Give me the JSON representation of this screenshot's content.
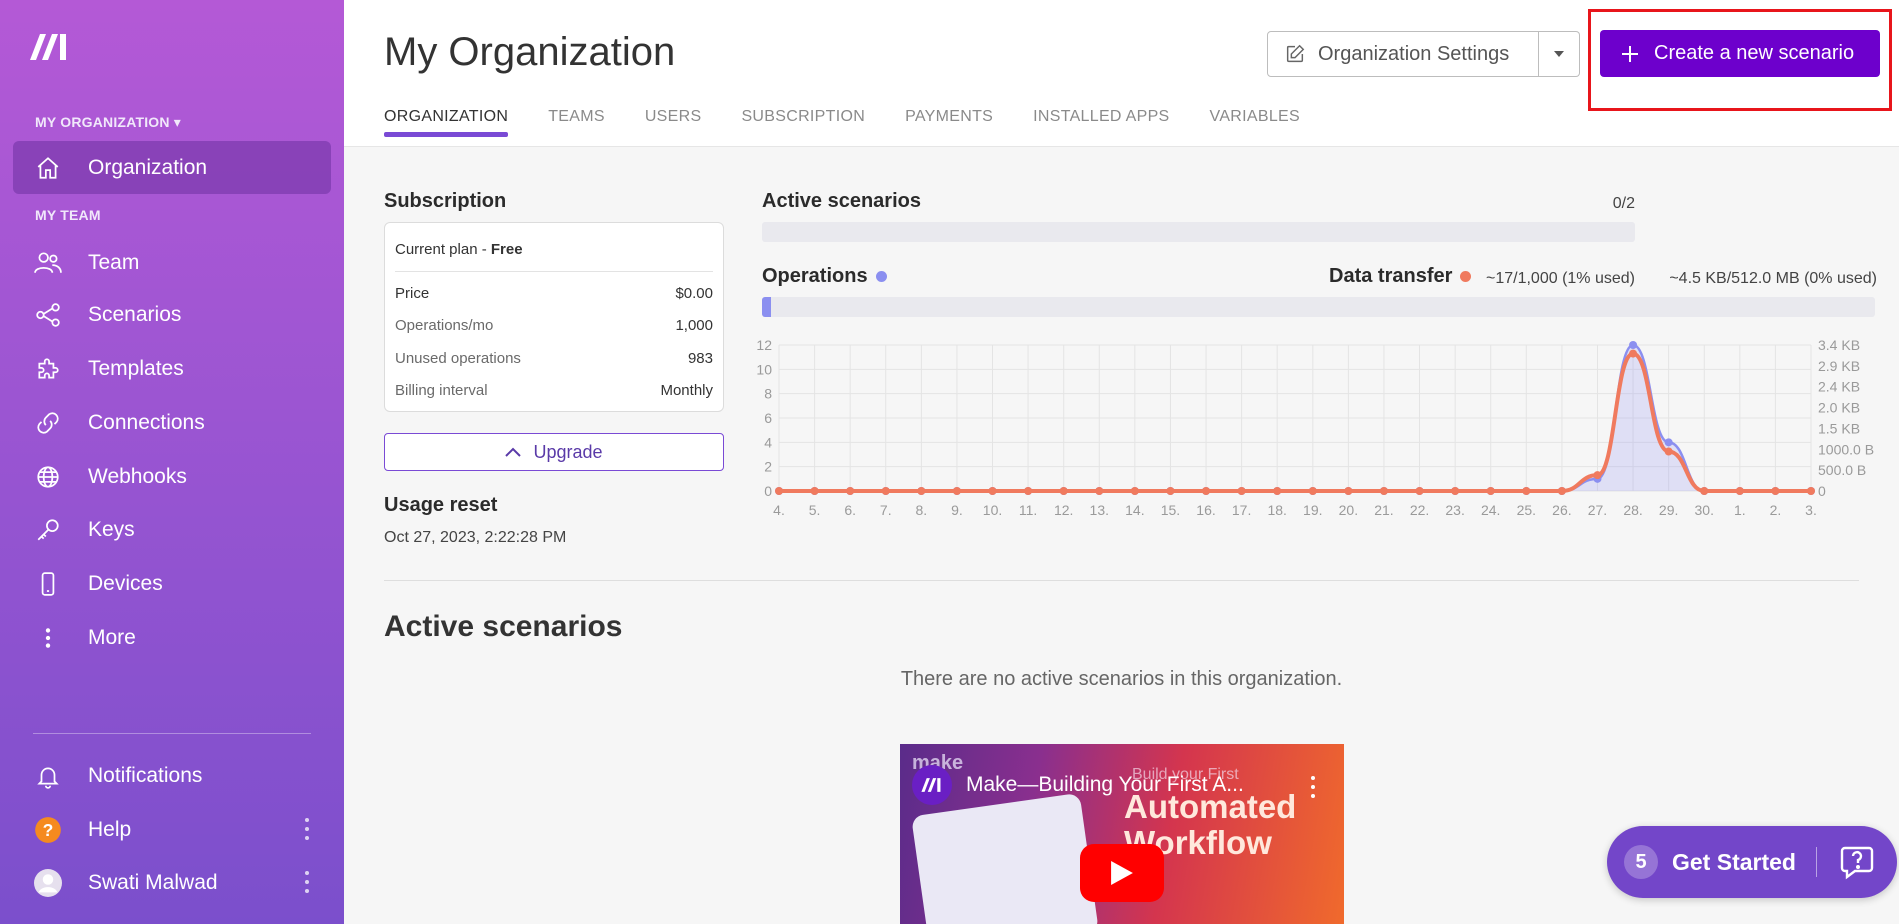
{
  "sidebar": {
    "org_label": "MY ORGANIZATION",
    "team_label": "MY TEAM",
    "items": [
      {
        "label": "Organization",
        "icon": "home-icon"
      },
      {
        "label": "Team",
        "icon": "users-icon"
      },
      {
        "label": "Scenarios",
        "icon": "share-nodes-icon"
      },
      {
        "label": "Templates",
        "icon": "puzzle-icon"
      },
      {
        "label": "Connections",
        "icon": "link-icon"
      },
      {
        "label": "Webhooks",
        "icon": "globe-icon"
      },
      {
        "label": "Keys",
        "icon": "key-icon"
      },
      {
        "label": "Devices",
        "icon": "mobile-icon"
      },
      {
        "label": "More",
        "icon": "more-vertical-icon"
      }
    ],
    "bottom": [
      {
        "label": "Notifications",
        "icon": "bell-icon"
      },
      {
        "label": "Help",
        "icon": "help-icon"
      },
      {
        "label": "Swati Malwad",
        "icon": "avatar-icon"
      }
    ]
  },
  "header": {
    "title": "My Organization",
    "settings_label": "Organization Settings",
    "create_label": "Create a new scenario",
    "tabs": [
      "ORGANIZATION",
      "TEAMS",
      "USERS",
      "SUBSCRIPTION",
      "PAYMENTS",
      "INSTALLED APPS",
      "VARIABLES"
    ],
    "active_tab": "ORGANIZATION"
  },
  "subscription": {
    "title": "Subscription",
    "plan_prefix": "Current plan - ",
    "plan_name": "Free",
    "rows": [
      {
        "label": "Price",
        "value": "$0.00"
      },
      {
        "label": "Operations/mo",
        "value": "1,000"
      },
      {
        "label": "Unused operations",
        "value": "983"
      },
      {
        "label": "Billing interval",
        "value": "Monthly"
      }
    ],
    "upgrade_label": "Upgrade",
    "usage_reset_title": "Usage reset",
    "usage_reset_date": "Oct 27, 2023, 2:22:28 PM"
  },
  "stats": {
    "active_scenarios": {
      "title": "Active scenarios",
      "value": "0/2",
      "fraction": 0
    },
    "operations": {
      "title": "Operations",
      "value": "~17/1,000 (1% used)",
      "fraction": 0.01,
      "color": "#8b8ff0"
    },
    "data_transfer": {
      "title": "Data transfer",
      "value": "~4.5 KB/512.0 MB (0% used)",
      "fraction": 0,
      "color": "#f07a5e"
    }
  },
  "chart_data": {
    "type": "line",
    "categories": [
      "4.",
      "5.",
      "6.",
      "7.",
      "8.",
      "9.",
      "10.",
      "11.",
      "12.",
      "13.",
      "14.",
      "15.",
      "16.",
      "17.",
      "18.",
      "19.",
      "20.",
      "21.",
      "22.",
      "23.",
      "24.",
      "25.",
      "26.",
      "27.",
      "28.",
      "29.",
      "30.",
      "1.",
      "2.",
      "3."
    ],
    "y_left_ticks": [
      "0",
      "2",
      "4",
      "6",
      "8",
      "10",
      "12"
    ],
    "y_right_ticks": [
      "0",
      "500.0 B",
      "1000.0 B",
      "1.5 KB",
      "2.0 KB",
      "2.4 KB",
      "2.9 KB",
      "3.4 KB"
    ],
    "ylim_left": [
      0,
      12
    ],
    "ylim_right_kb": [
      0,
      3.4
    ],
    "grid": true,
    "series": [
      {
        "axis": "left",
        "color": "#8b8ff0",
        "values": [
          0,
          0,
          0,
          0,
          0,
          0,
          0,
          0,
          0,
          0,
          0,
          0,
          0,
          0,
          0,
          0,
          0,
          0,
          0,
          0,
          0,
          0,
          0,
          1,
          12,
          4,
          0,
          0,
          0,
          0
        ]
      },
      {
        "axis": "right",
        "color": "#f07a5e",
        "values": [
          0,
          0,
          0,
          0,
          0,
          0,
          0,
          0,
          0,
          0,
          0,
          0,
          0,
          0,
          0,
          0,
          0,
          0,
          0,
          0,
          0,
          0,
          0,
          0.37,
          3.2,
          0.92,
          0,
          0,
          0,
          0
        ]
      }
    ]
  },
  "active_section": {
    "title": "Active scenarios",
    "empty_message": "There are no active scenarios in this organization."
  },
  "video": {
    "brand": "make",
    "title": "Make—Building Your First A...",
    "subtitle": "Build your First",
    "big_line1": "Automated",
    "big_line2": "Workflow"
  },
  "get_started": {
    "count": "5",
    "label": "Get Started"
  }
}
